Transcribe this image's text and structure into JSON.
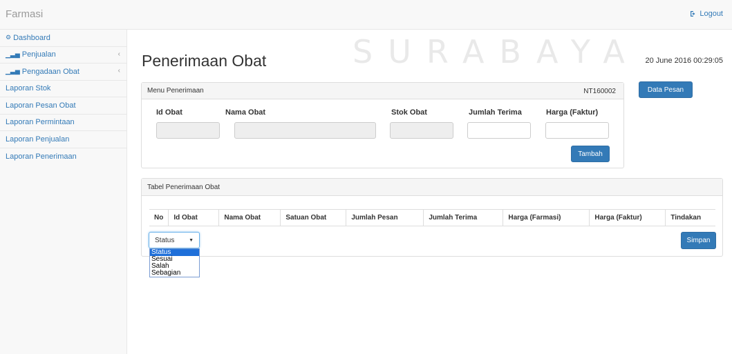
{
  "navbar": {
    "brand": "Farmasi",
    "logout_label": "Logout"
  },
  "watermark": {
    "text": "SURABAYA"
  },
  "sidebar": {
    "items": [
      {
        "label": "Dashboard",
        "icon": "dashboard-icon"
      },
      {
        "label": "Penjualan",
        "icon": "bar-chart-icon"
      },
      {
        "label": "Pengadaan Obat",
        "icon": "bar-chart-icon"
      },
      {
        "label": "Laporan Stok"
      },
      {
        "label": "Laporan Pesan Obat"
      },
      {
        "label": "Laporan Permintaan"
      },
      {
        "label": "Laporan Penjualan"
      },
      {
        "label": "Laporan Penerimaan"
      }
    ]
  },
  "page": {
    "title": "Penerimaan Obat",
    "datetime": "20 June 2016 00:29:05"
  },
  "menu_panel": {
    "heading": "Menu Penerimaan",
    "code": "NT160002",
    "labels": {
      "id_obat": "Id Obat",
      "nama_obat": "Nama Obat",
      "stok_obat": "Stok Obat",
      "jumlah_terima": "Jumlah Terima",
      "harga_faktur": "Harga (Faktur)"
    },
    "values": {
      "id_obat": "",
      "nama_obat": "",
      "stok_obat": "",
      "jumlah_terima": "",
      "harga_faktur": ""
    },
    "tambah_label": "Tambah"
  },
  "data_pesan_label": "Data Pesan",
  "table_panel": {
    "heading": "Tabel Penerimaan Obat",
    "columns": [
      "No",
      "Id Obat",
      "Nama Obat",
      "Satuan Obat",
      "Jumlah Pesan",
      "Jumlah Terima",
      "Harga (Farmasi)",
      "Harga (Faktur)",
      "Tindakan"
    ],
    "status_select": {
      "value": "Status",
      "options": [
        "Status",
        "Sesuai",
        "Salah",
        "Sebagian"
      ]
    },
    "simpan_label": "Simpan"
  },
  "colors": {
    "primary": "#337ab7",
    "link": "#337ab7",
    "navbar_bg": "#f8f8f8",
    "panel_heading_bg": "#f5f5f5",
    "dropdown_highlight": "#1e6fd9"
  }
}
